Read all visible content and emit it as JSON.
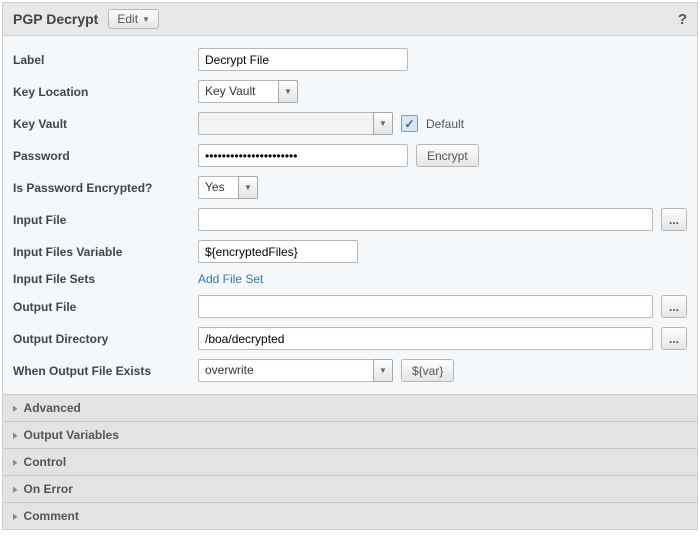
{
  "header": {
    "title": "PGP Decrypt",
    "edit": "Edit"
  },
  "labels": {
    "label": "Label",
    "keyLocation": "Key Location",
    "keyVault": "Key Vault",
    "password": "Password",
    "isPwdEnc": "Is Password Encrypted?",
    "inputFile": "Input File",
    "inputFilesVar": "Input Files Variable",
    "inputFileSets": "Input File Sets",
    "outputFile": "Output File",
    "outputDir": "Output Directory",
    "whenExists": "When Output File Exists"
  },
  "values": {
    "label": "Decrypt File",
    "keyLocation": "Key Vault",
    "keyVault": "",
    "defaultLabel": "Default",
    "password": "••••••••••••••••••••••",
    "encryptBtn": "Encrypt",
    "isPwdEnc": "Yes",
    "inputFile": "",
    "inputFilesVar": "${encryptedFiles}",
    "addFileSet": "Add File Set",
    "outputFile": "",
    "outputDir": "/boa/decrypted",
    "whenExists": "overwrite",
    "varBtn": "${var}",
    "browse": "..."
  },
  "accordion": [
    "Advanced",
    "Output Variables",
    "Control",
    "On Error",
    "Comment"
  ]
}
